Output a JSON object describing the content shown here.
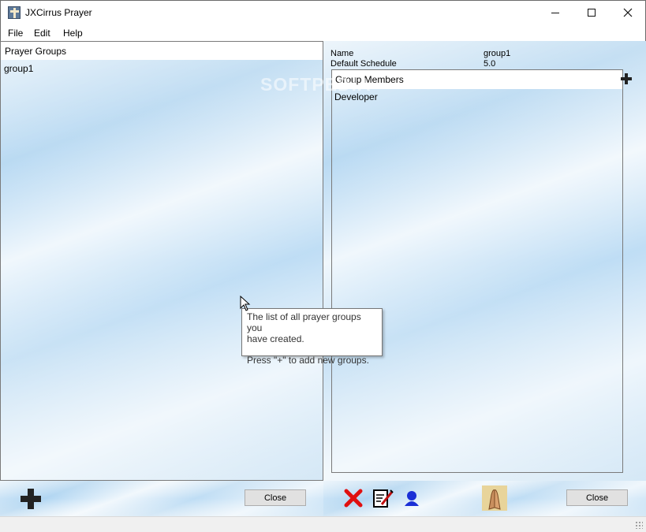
{
  "window": {
    "title": "JXCirrus Prayer"
  },
  "menu": {
    "file": "File",
    "edit": "Edit",
    "help": "Help"
  },
  "prayer_groups": {
    "header": "Prayer Groups",
    "items": [
      "group1"
    ]
  },
  "details": {
    "name_label": "Name",
    "name_value": "group1",
    "schedule_label": "Default Schedule",
    "schedule_value": "5.0"
  },
  "group_members": {
    "header": "Group Members",
    "items": [
      "Developer"
    ]
  },
  "tooltip": {
    "line1": "The list of all prayer groups you",
    "line2": "have created.",
    "line3": "Press \"+\" to add new groups."
  },
  "buttons": {
    "close_left": "Close",
    "close_right": "Close"
  },
  "watermark": "SOFTPEDIA",
  "icons": {
    "add_group": "plus-icon",
    "add_member": "plus-icon",
    "delete": "red-x-icon",
    "edit": "notepad-pen-icon",
    "person": "person-icon",
    "pray": "praying-hands-icon"
  },
  "colors": {
    "sky": "#9ccbef",
    "delete_red": "#e01010",
    "person_blue": "#1a2fd6"
  }
}
